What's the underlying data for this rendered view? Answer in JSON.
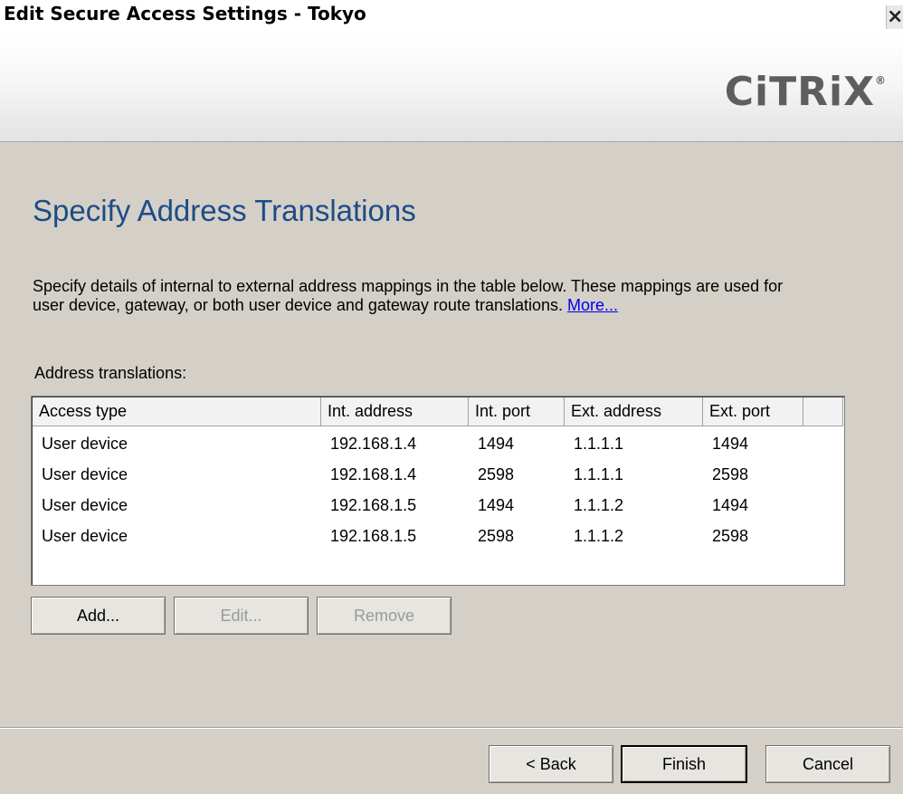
{
  "window": {
    "title": "Edit Secure Access Settings - Tokyo",
    "close_glyph": "×"
  },
  "banner": {
    "logo_text": "CiTRiX",
    "logo_mark": "®"
  },
  "page": {
    "heading": "Specify Address Translations",
    "description": "Specify details of internal to external address mappings in the table below. These mappings are used for user device, gateway, or both user device and gateway route translations.",
    "more_link": "More...",
    "table_label": "Address translations:"
  },
  "table": {
    "columns": [
      "Access type",
      "Int. address",
      "Int. port",
      "Ext. address",
      "Ext. port"
    ],
    "rows": [
      [
        "User device",
        "192.168.1.4",
        "1494",
        "1.1.1.1",
        "1494"
      ],
      [
        "User device",
        "192.168.1.4",
        "2598",
        "1.1.1.1",
        "2598"
      ],
      [
        "User device",
        "192.168.1.5",
        "1494",
        "1.1.1.2",
        "1494"
      ],
      [
        "User device",
        "192.168.1.5",
        "2598",
        "1.1.1.2",
        "2598"
      ]
    ]
  },
  "actions": {
    "add": "Add...",
    "edit": "Edit...",
    "remove": "Remove"
  },
  "nav": {
    "back": "< Back",
    "finish": "Finish",
    "cancel": "Cancel"
  }
}
